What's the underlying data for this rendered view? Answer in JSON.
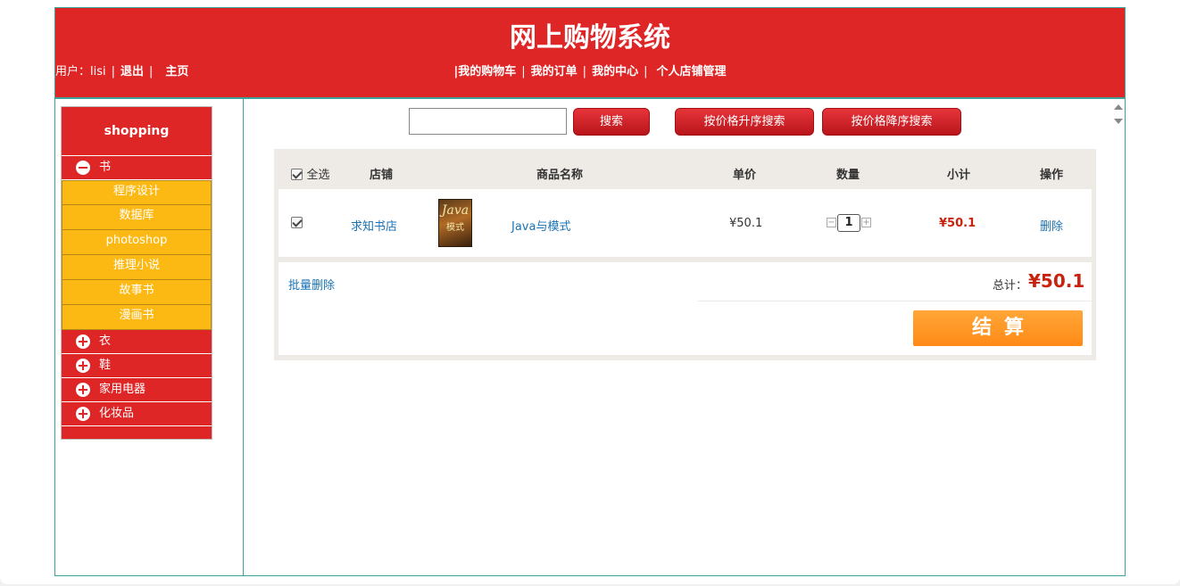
{
  "header": {
    "title": "网上购物系统",
    "user_label": "用户：lisi",
    "logout": "退出",
    "home": "主页",
    "nav": {
      "cart": "|我的购物车",
      "orders": "我的订单",
      "center": "我的中心",
      "shop_admin": "个人店铺管理"
    }
  },
  "sidebar": {
    "title": "shopping",
    "categories": [
      {
        "label": "书",
        "expanded": true,
        "icon": "minus-circle-icon"
      },
      {
        "label": "衣",
        "expanded": false,
        "icon": "plus-circle-icon"
      },
      {
        "label": "鞋",
        "expanded": false,
        "icon": "plus-circle-icon"
      },
      {
        "label": "家用电器",
        "expanded": false,
        "icon": "plus-circle-icon"
      },
      {
        "label": "化妆品",
        "expanded": false,
        "icon": "plus-circle-icon"
      }
    ],
    "book_subcategories": [
      "程序设计",
      "数据库",
      "photoshop",
      "推理小说",
      "故事书",
      "漫画书"
    ]
  },
  "search": {
    "value": "",
    "search_label": "搜索",
    "asc_label": "按价格升序搜索",
    "desc_label": "按价格降序搜索"
  },
  "cart": {
    "headers": {
      "select_all": "全选",
      "shop": "店铺",
      "product": "商品名称",
      "unit_price": "单价",
      "quantity": "数量",
      "subtotal": "小计",
      "action": "操作"
    },
    "items": [
      {
        "checked": true,
        "shop": "求知书店",
        "cover_title": "Java",
        "cover_subtitle": "模式",
        "name": "Java与模式",
        "price": "¥50.1",
        "quantity": "1",
        "subtotal": "¥50.1",
        "action": "删除"
      }
    ],
    "bulk_delete": "批量删除",
    "total_label": "总计：",
    "total": "¥50.1",
    "checkout_label": "结算"
  },
  "colors": {
    "brand_red": "#df2627",
    "sub_yellow": "#fdb913",
    "frame_teal": "#3aa39a",
    "checkout_orange": "#ff931f",
    "price_red": "#c8230f",
    "link_blue": "#1a73b5"
  }
}
